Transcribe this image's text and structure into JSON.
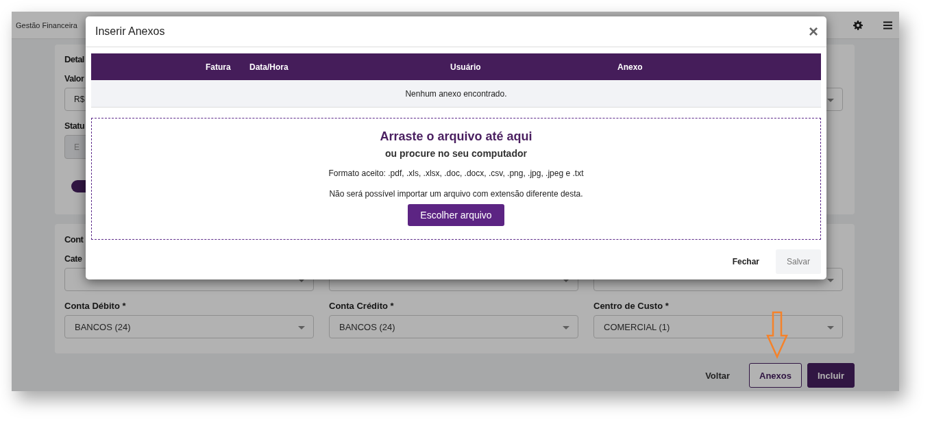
{
  "app": {
    "title": "Gestão Financeira"
  },
  "details_card": {
    "title": "Detal",
    "fields": [
      {
        "label": "Valor",
        "value": "R$",
        "disabled": false
      },
      {
        "label": "Statu",
        "placeholder": "E",
        "disabled": true
      }
    ]
  },
  "accounts_card": {
    "title": "Cont",
    "rows": [
      [
        {
          "label": "Cate"
        },
        {},
        {}
      ],
      [
        {
          "label": "Conta Débito *",
          "value": "BANCOS (24)"
        },
        {
          "label": "Conta Crédito *",
          "value": "BANCOS (24)"
        },
        {
          "label": "Centro de Custo *",
          "value": "COMERCIAL (1)"
        }
      ]
    ]
  },
  "actions": [
    {
      "label": "Voltar",
      "kind": "text"
    },
    {
      "label": "Anexos",
      "kind": "outline"
    },
    {
      "label": "Incluir",
      "kind": "primary"
    }
  ],
  "modal": {
    "title": "Inserir Anexos",
    "close": "×",
    "table": {
      "columns": [
        "Fatura",
        "Data/Hora",
        "Usuário",
        "Anexo"
      ],
      "empty_message": "Nenhum anexo encontrado."
    },
    "dropzone": {
      "title": "Arraste o arquivo até aqui",
      "subtitle": "ou procure no seu computador",
      "formats": "Formato aceito: .pdf, .xls, .xlsx, .doc, .docx, .csv, .png, .jpg, .jpeg e .txt",
      "warning": "Não será possível importar um arquivo com extensão diferente desta.",
      "button": "Escolher arquivo"
    },
    "buttons": [
      {
        "label": "Fechar",
        "disabled": false
      },
      {
        "label": "Salvar",
        "disabled": true
      }
    ]
  }
}
